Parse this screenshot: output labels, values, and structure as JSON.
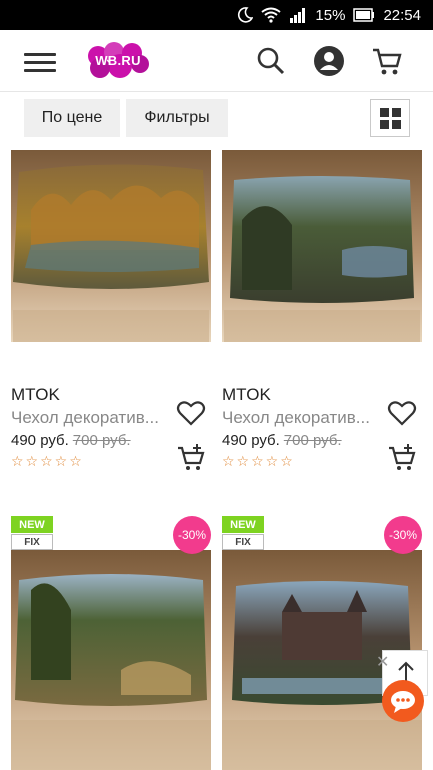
{
  "status_bar": {
    "battery": "15%",
    "time": "22:54"
  },
  "header": {
    "logo_text": "WB.RU"
  },
  "toolbar": {
    "sort_label": "По цене",
    "filter_label": "Фильтры"
  },
  "products": [
    {
      "brand": "MTOK",
      "name": "Чехол декоратив...",
      "price": "490 руб.",
      "old_price": "700 руб.",
      "rating": "☆☆☆☆☆"
    },
    {
      "brand": "MTOK",
      "name": "Чехол декоратив...",
      "price": "490 руб.",
      "old_price": "700 руб.",
      "rating": "☆☆☆☆☆"
    },
    {
      "badge_new": "NEW",
      "badge_fix": "FIX",
      "discount": "-30%"
    },
    {
      "badge_new": "NEW",
      "badge_fix": "FIX",
      "discount": "-30%"
    }
  ],
  "colors": {
    "brand_pink": "#cb11ab",
    "discount_badge": "#f23b8d",
    "new_badge": "#7ed321",
    "chat_button": "#f25a1e",
    "star": "#e08a3a"
  }
}
